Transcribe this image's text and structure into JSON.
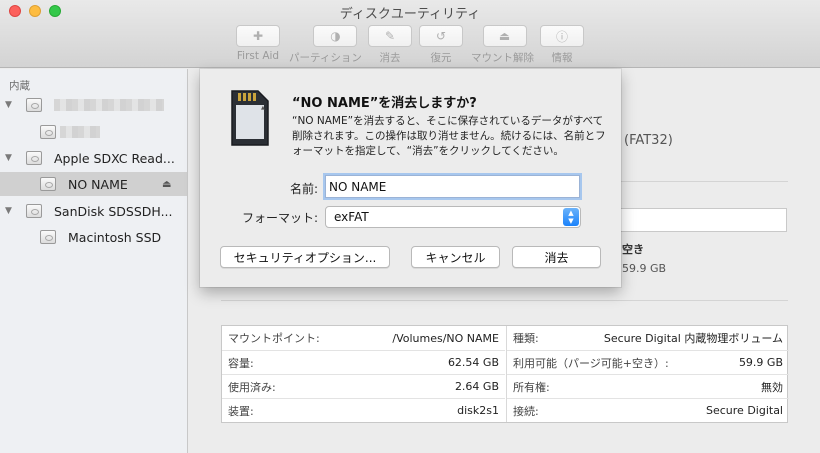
{
  "window": {
    "title": "ディスクユーティリティ"
  },
  "toolbar": {
    "buttons": [
      {
        "label": "First Aid",
        "icon": "stethoscope-icon",
        "glyph": "✚"
      },
      {
        "label": "パーティション",
        "icon": "partition-icon",
        "glyph": "◑"
      },
      {
        "label": "消去",
        "icon": "erase-icon",
        "glyph": "✎"
      },
      {
        "label": "復元",
        "icon": "restore-icon",
        "glyph": "↺"
      },
      {
        "label": "マウント解除",
        "icon": "unmount-icon",
        "glyph": "⏏"
      },
      {
        "label": "情報",
        "icon": "info-icon",
        "glyph": "ⓘ"
      }
    ]
  },
  "sidebar": {
    "heading": "内蔵",
    "items": [
      {
        "label": "Apple SDXC Read..."
      },
      {
        "label": "NO NAME"
      },
      {
        "label": "SanDisk SDSSDH..."
      },
      {
        "label": "Macintosh SSD"
      }
    ]
  },
  "background": {
    "filesystem": "(FAT32)",
    "free_label": "空き",
    "free_value": "59.9 GB"
  },
  "dialog": {
    "title": "“NO NAME”を消去しますか?",
    "message": "“NO NAME”を消去すると、そこに保存されているデータがすべて削除されます。この操作は取り消せません。続けるには、名前とフォーマットを指定して、“消去”をクリックしてください。",
    "name_label": "名前:",
    "name_value": "NO NAME",
    "format_label": "フォーマット:",
    "format_value": "exFAT",
    "security_button": "セキュリティオプション...",
    "cancel_button": "キャンセル",
    "erase_button": "消去"
  },
  "info": {
    "left": [
      {
        "key": "マウントポイント:",
        "value": "/Volumes/NO NAME"
      },
      {
        "key": "容量:",
        "value": "62.54 GB"
      },
      {
        "key": "使用済み:",
        "value": "2.64 GB"
      },
      {
        "key": "装置:",
        "value": "disk2s1"
      }
    ],
    "right": [
      {
        "key": "種類:",
        "value": "Secure Digital 内蔵物理ボリューム"
      },
      {
        "key": "利用可能（パージ可能+空き）:",
        "value": "59.9 GB"
      },
      {
        "key": "所有権:",
        "value": "無効"
      },
      {
        "key": "接続:",
        "value": "Secure Digital"
      }
    ]
  }
}
